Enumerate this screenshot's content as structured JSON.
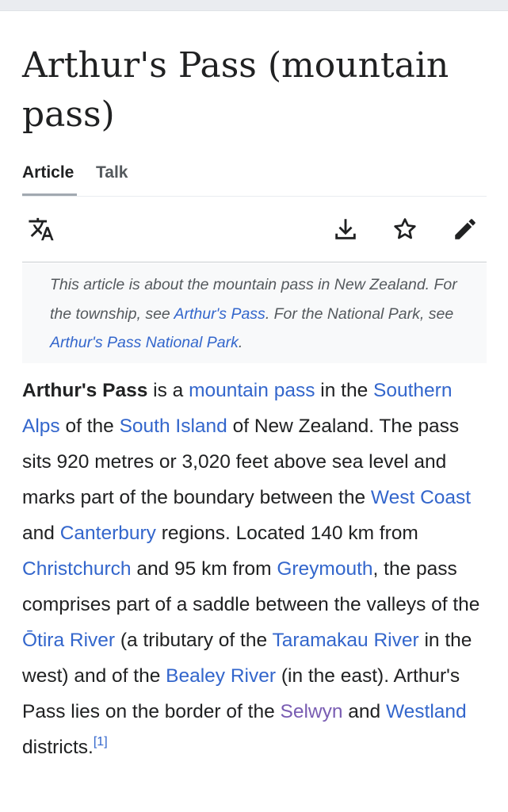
{
  "page": {
    "title": "Arthur's Pass (mountain pass)"
  },
  "tabs": [
    {
      "label": "Article"
    },
    {
      "label": "Talk"
    }
  ],
  "toolbar": {
    "icons": [
      "language-icon",
      "download-icon",
      "star-icon",
      "edit-pencil-icon"
    ]
  },
  "hatnote": {
    "t1": "This article is about the mountain pass in New Zealand. For the township, see ",
    "link1": "Arthur's Pass",
    "t2": ". For the National Park, see ",
    "link2": "Arthur's Pass National Park",
    "t3": "."
  },
  "intro": {
    "bold": "Arthur's Pass",
    "t1": " is a ",
    "l_mountain_pass": "mountain pass",
    "t2": " in the ",
    "l_southern_alps": "Southern Alps",
    "t3": " of the ",
    "l_south_island": "South Island",
    "t4": " of New Zealand. The pass sits 920 metres or 3,020 feet above sea level and marks part of the boundary between the ",
    "l_west_coast": "West Coast",
    "t5": " and ",
    "l_canterbury": "Canterbury",
    "t6": " regions. Located 140 km from ",
    "l_christchurch": "Christchurch",
    "t7": " and 95 km from ",
    "l_greymouth": "Greymouth",
    "t8": ", the pass comprises part of a saddle between the valleys of the ",
    "l_otira": "Ōtira River",
    "t9": " (a tributary of the ",
    "l_taramakau": "Taramakau River",
    "t10": " in the west) and of the ",
    "l_bealey": "Bealey River",
    "t11": " (in the east). Arthur's Pass lies on the border of the ",
    "l_selwyn": "Selwyn",
    "t12": " and ",
    "l_westland": "Westland",
    "t13": " districts.",
    "ref": "[1]"
  },
  "colors": {
    "link": "#3366cc",
    "visited_link": "#795cb2",
    "text": "#202122",
    "hatnote_bg": "#f8f9fa"
  }
}
